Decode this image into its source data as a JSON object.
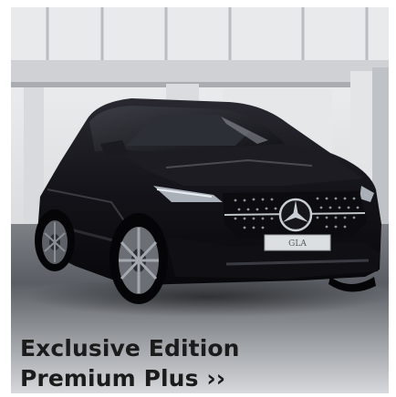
{
  "tile": {
    "title_line1": "Exclusive Edition",
    "title_line2": "Premium Plus ››",
    "plate_text": "GLA"
  },
  "colors": {
    "car_body": "#141319",
    "showroom_ceiling": "#e9eaeb",
    "floor": "#4b4f55",
    "caption_text": "#1b1b1b"
  }
}
